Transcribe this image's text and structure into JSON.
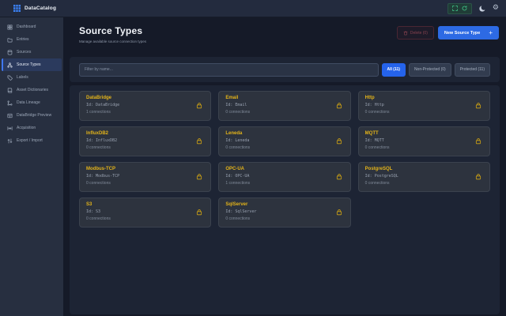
{
  "topbar": {
    "app_name": "DataCatalog"
  },
  "header": {
    "title": "Source Types",
    "subtitle": "Manage available source connection types",
    "delete_label": "Delete (0)",
    "new_label": "New Source Type",
    "new_plus": "+"
  },
  "filters": {
    "placeholder": "Filter by name...",
    "buttons": [
      {
        "label": "All (11)",
        "active": true
      },
      {
        "label": "Non-Protected (0)",
        "active": false
      },
      {
        "label": "Protected (11)",
        "active": false
      }
    ]
  },
  "sidebar": {
    "items": [
      {
        "label": "Dashboard",
        "active": false
      },
      {
        "label": "Entries",
        "active": false
      },
      {
        "label": "Sources",
        "active": false
      },
      {
        "label": "Source Types",
        "active": true
      },
      {
        "label": "Labels",
        "active": false
      },
      {
        "label": "Asset Dictionaries",
        "active": false
      },
      {
        "label": "Data Lineage",
        "active": false
      },
      {
        "label": "DataBridge Preview",
        "active": false
      },
      {
        "label": "Acquisition",
        "active": false
      },
      {
        "label": "Export / Import",
        "active": false
      }
    ]
  },
  "cards": [
    {
      "title": "DataBridge",
      "id_text": "Id: DataBridge",
      "connections_text": "1 connections",
      "protected": true
    },
    {
      "title": "Email",
      "id_text": "Id: Email",
      "connections_text": "0 connections",
      "protected": true
    },
    {
      "title": "Http",
      "id_text": "Id: Http",
      "connections_text": "0 connections",
      "protected": true
    },
    {
      "title": "InfluxDB2",
      "id_text": "Id: InfluxDB2",
      "connections_text": "0 connections",
      "protected": true
    },
    {
      "title": "Leneda",
      "id_text": "Id: Leneda",
      "connections_text": "0 connections",
      "protected": true
    },
    {
      "title": "MQTT",
      "id_text": "Id: MQTT",
      "connections_text": "0 connections",
      "protected": true
    },
    {
      "title": "Modbus-TCP",
      "id_text": "Id: Modbus-TCP",
      "connections_text": "0 connections",
      "protected": true
    },
    {
      "title": "OPC-UA",
      "id_text": "Id: OPC-UA",
      "connections_text": "1 connections",
      "protected": true
    },
    {
      "title": "PostgreSQL",
      "id_text": "Id: PostgreSQL",
      "connections_text": "0 connections",
      "protected": true
    },
    {
      "title": "S3",
      "id_text": "Id: S3",
      "connections_text": "0 connections",
      "protected": true
    },
    {
      "title": "SqlServer",
      "id_text": "Id: SqlServer",
      "connections_text": "0 connections",
      "protected": true
    }
  ],
  "colors": {
    "accent_blue": "#2d6ae4",
    "active_filter_blue": "#2563eb",
    "sidebar_active_border": "#4078f0",
    "card_title_yellow": "#e4b419",
    "lock_yellow": "#d2a513",
    "status_green": "#3fbf86",
    "delete_red": "#8a4350"
  }
}
